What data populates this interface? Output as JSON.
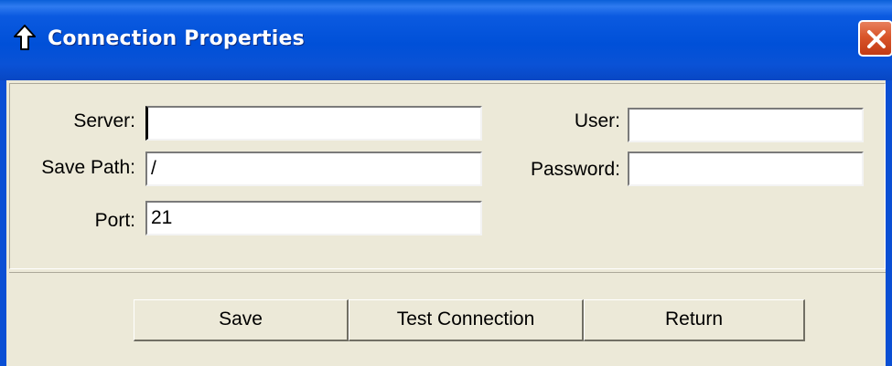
{
  "window": {
    "title": "Connection Properties",
    "title_icon": "up-arrow-icon",
    "close_icon": "close-icon"
  },
  "form": {
    "server_label": "Server:",
    "server_value": "",
    "save_path_label": "Save Path:",
    "save_path_value": "/",
    "port_label": "Port:",
    "port_value": "21",
    "user_label": "User:",
    "user_value": "",
    "password_label": "Password:",
    "password_value": ""
  },
  "buttons": {
    "save_label": "Save",
    "test_label": "Test Connection",
    "return_label": "Return"
  },
  "colors": {
    "titlebar": "#0050d8",
    "close": "#d9552a",
    "panel": "#ece9d8"
  }
}
